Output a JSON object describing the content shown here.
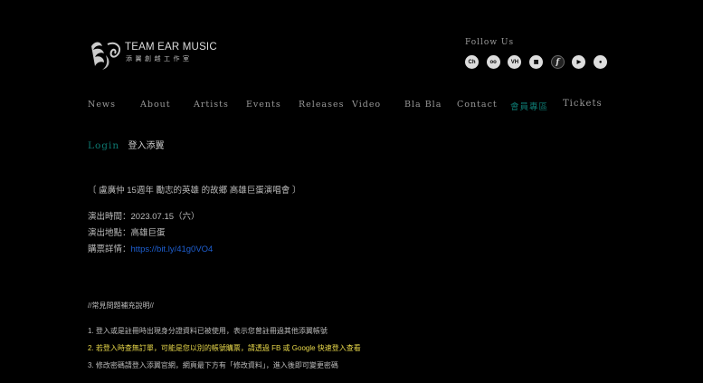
{
  "logo": {
    "title": "TEAM EAR MUSIC",
    "subtitle": "添翼創越工作室"
  },
  "follow": {
    "label": "Follow Us"
  },
  "social_icons": [
    {
      "name": "icon-1-icon",
      "glyph": "Ch"
    },
    {
      "name": "glasses-icon",
      "glyph": "oo"
    },
    {
      "name": "vh-icon",
      "glyph": "VH"
    },
    {
      "name": "grid-icon",
      "glyph": "▦"
    },
    {
      "name": "facebook-icon",
      "glyph": "f"
    },
    {
      "name": "youtube-icon",
      "glyph": "▶"
    },
    {
      "name": "user-icon",
      "glyph": "●"
    }
  ],
  "nav": {
    "items": [
      "News",
      "About",
      "Artists",
      "Events",
      "Releases",
      "Video",
      "Bla Bla",
      "Contact",
      "會員專區",
      "Tickets"
    ]
  },
  "login": {
    "label": "Login",
    "zh": "登入添翼"
  },
  "event": {
    "title": "〔 盧廣仲 15週年 勵志的英雄 的故鄉 高雄巨蛋演唱會 〕",
    "date": "演出時間：2023.07.15（六）",
    "venue": "演出地點：高雄巨蛋",
    "ticket_prefix": "購票詳情：",
    "ticket_link": "https://bit.ly/41g0VO4"
  },
  "faq": {
    "heading": "//常見問題補充說明//",
    "items": [
      "1. 登入或是註冊時出現身分證資料已被使用，表示您曾註冊過其他添翼帳號",
      "2. 若登入時查無訂單，可能是您以別的帳號購票，請透過 FB 或 Google 快速登入查看",
      "3. 修改密碼請登入添翼官網，網頁最下方有「修改資料」，進入後即可變更密碼"
    ]
  }
}
